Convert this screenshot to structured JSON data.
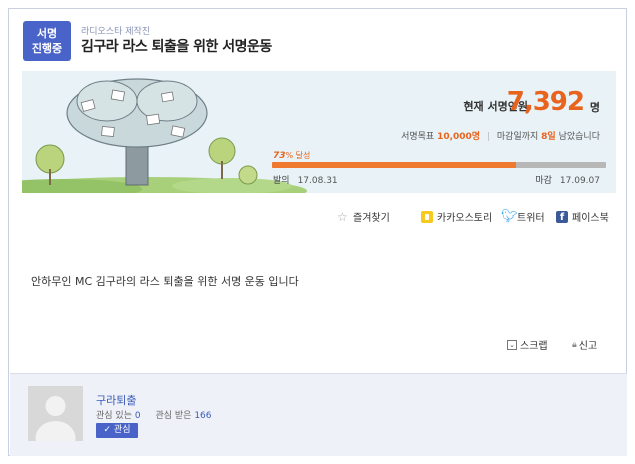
{
  "header": {
    "status_badge": "서명\n진행중",
    "producer": "라디오스타 제작진",
    "title": "김구라 라스 퇴출을 위한 서명운동"
  },
  "stats": {
    "count_label": "현재 서명인원",
    "count_value": "7,392",
    "count_unit": "명",
    "goal_prefix": "서명목표",
    "goal_value": "10,000명",
    "deadline_prefix": "마감일까지",
    "deadline_days": "8일",
    "deadline_suffix": "남았습니다",
    "progress_percent": 73,
    "progress_pct_text": "73",
    "progress_pct_suffix": "% 달성",
    "start_label": "발의",
    "start_date": "17.08.31",
    "end_label": "마감",
    "end_date": "17.09.07"
  },
  "share": {
    "favorite": "즐겨찾기",
    "kakao": "카카오스토리",
    "twitter": "트위터",
    "facebook": "페이스북"
  },
  "body": {
    "text": "안하무인 MC 김구라의 라스 퇴출을 위한 서명 운동 입니다"
  },
  "actions": {
    "scrap": "스크랩",
    "report": "신고"
  },
  "author": {
    "name": "구라퇴출",
    "interest_in_label": "관심 있는",
    "interest_in_count": "0",
    "interest_recv_label": "관심 받은",
    "interest_recv_count": "166",
    "interest_button": "관심"
  },
  "colors": {
    "accent": "#4a63c8",
    "orange": "#e8641e",
    "progress_fill": "#ef7a2f"
  }
}
